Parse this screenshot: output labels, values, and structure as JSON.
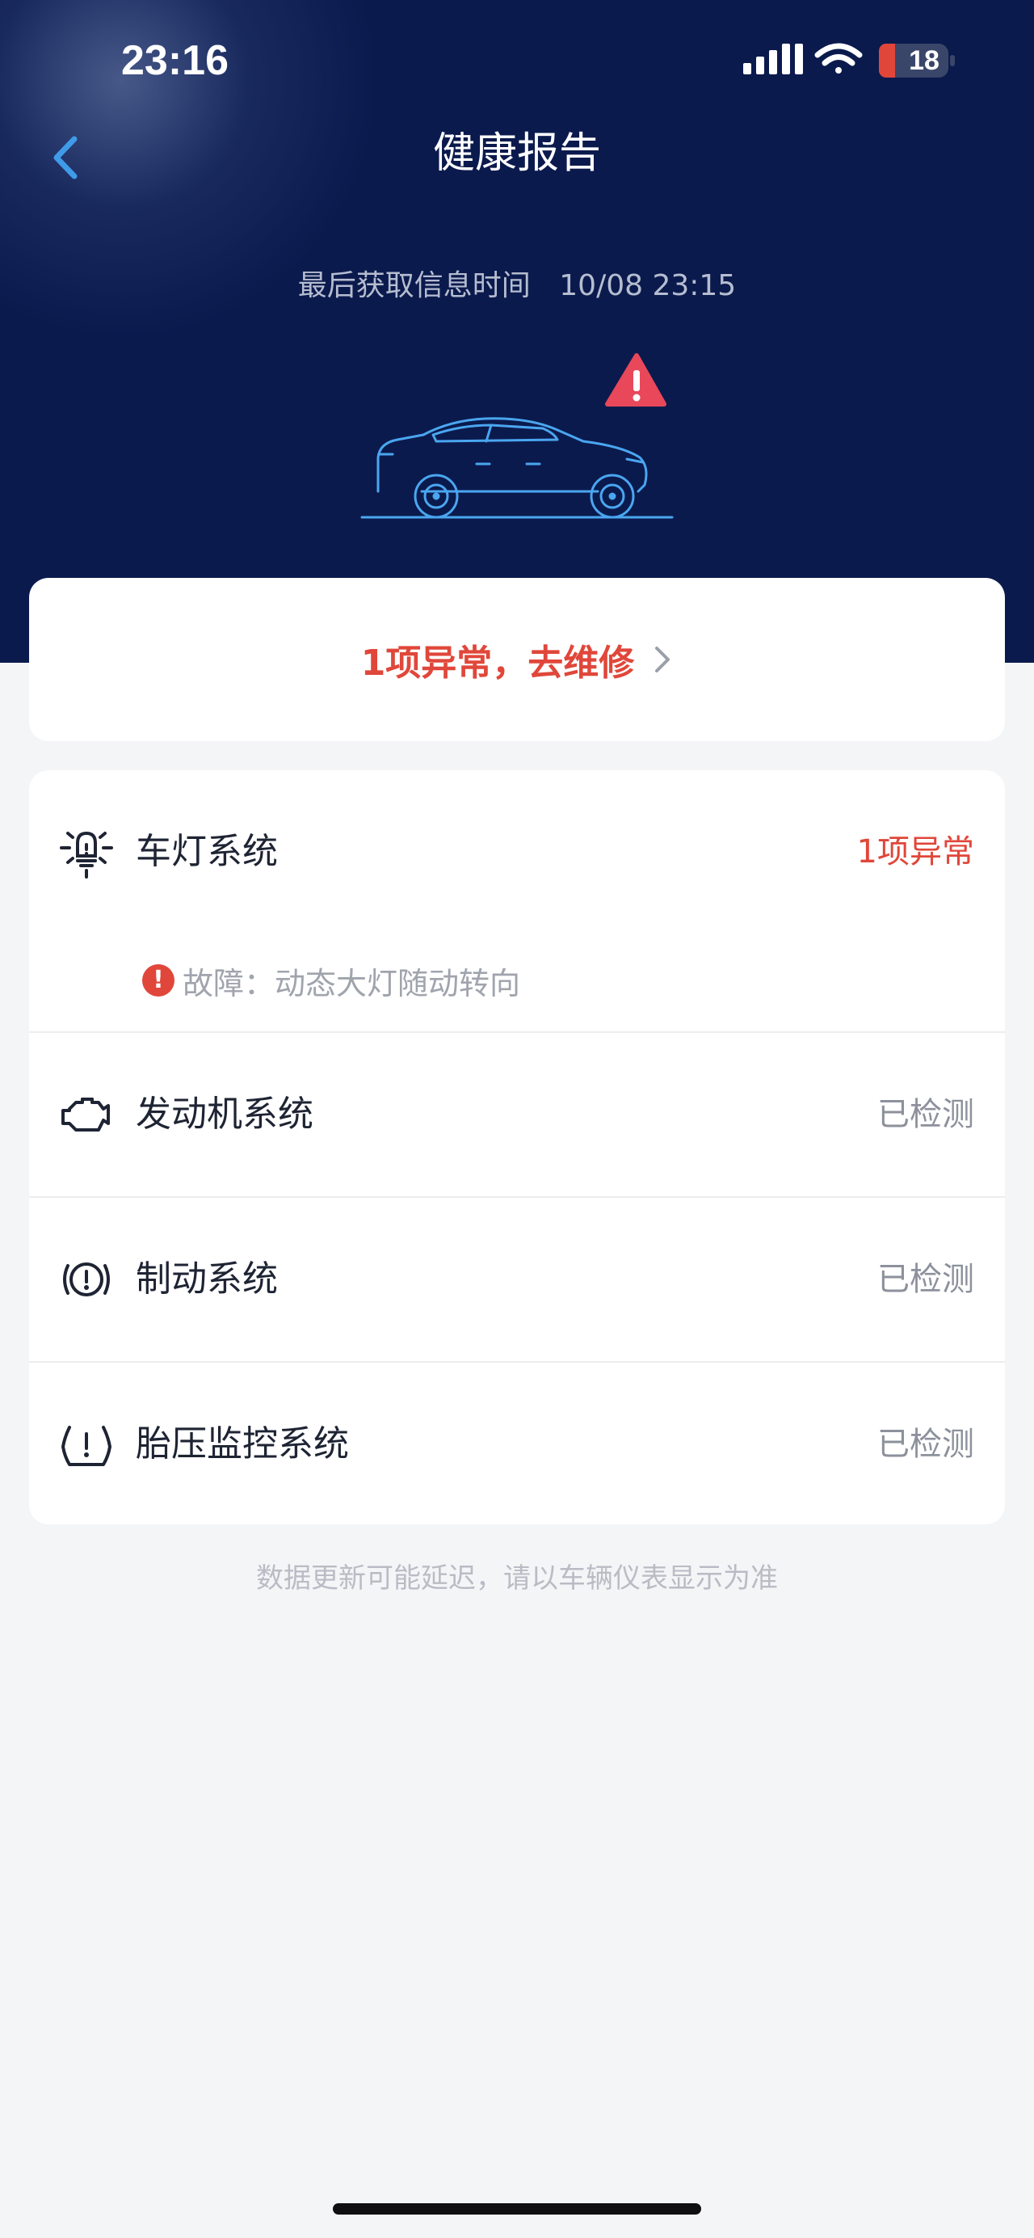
{
  "status_bar": {
    "time": "23:16",
    "battery": "18",
    "icons": [
      "cellular-signal-icon",
      "wifi-icon",
      "battery-icon"
    ]
  },
  "nav": {
    "back_icon": "chevron-left-icon",
    "title": "健康报告"
  },
  "info": {
    "last_update_label": "最后获取信息时间",
    "last_update_value": "10/08 23:15"
  },
  "repair": {
    "text": "1项异常，去维修",
    "chevron_icon": "chevron-right-icon"
  },
  "systems": [
    {
      "icon": "headlight-bulb-icon",
      "label": "车灯系统",
      "status": "1项异常",
      "alert": true,
      "fault": {
        "label": "故障：",
        "detail": "动态大灯随动转向"
      }
    },
    {
      "icon": "engine-icon",
      "label": "发动机系统",
      "status": "已检测",
      "alert": false
    },
    {
      "icon": "brake-warning-icon",
      "label": "制动系统",
      "status": "已检测",
      "alert": false
    },
    {
      "icon": "tire-pressure-icon",
      "label": "胎压监控系统",
      "status": "已检测",
      "alert": false
    }
  ],
  "footnote": "数据更新可能延迟，请以车辆仪表显示为准",
  "colors": {
    "hero_background": "#0B1A4D",
    "page_background": "#F4F5F7",
    "alert_red": "#E0473A",
    "back_blue": "#3F9BE8",
    "car_outline": "#4AA6F0"
  }
}
